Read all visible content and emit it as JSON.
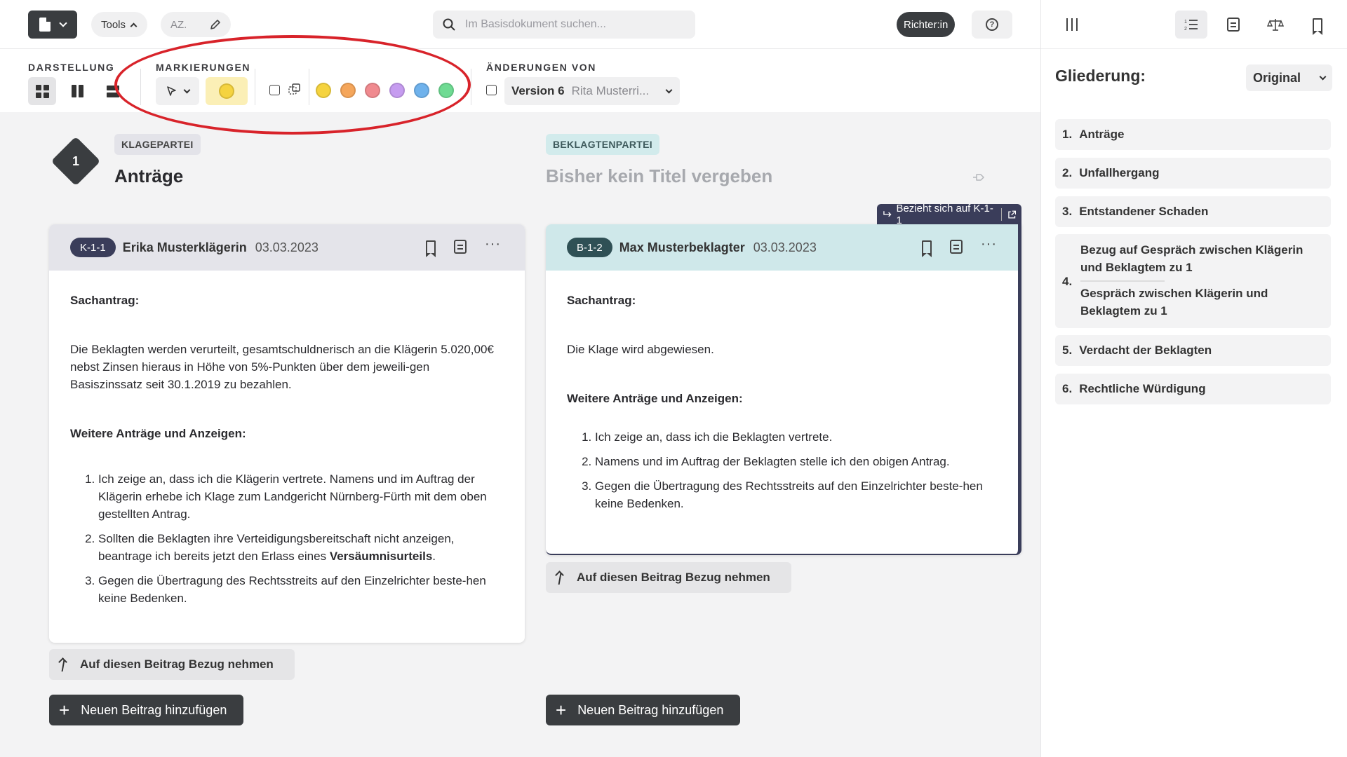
{
  "topbar": {
    "tools_label": "Tools",
    "az_label": "AZ.",
    "search_placeholder": "Im Basisdokument suchen...",
    "role_label": "Richter:in"
  },
  "toolbar": {
    "darstellung_label": "DARSTELLUNG",
    "markierungen_label": "MARKIERUNGEN",
    "aenderungen_label": "ÄNDERUNGEN VON",
    "active_highlight_color": "#f5d33f",
    "highlight_colors": [
      "#f5d33f",
      "#f5a65b",
      "#f08a8f",
      "#c69cf0",
      "#6fb2ec",
      "#6fdb93"
    ],
    "version_label": "Version 6",
    "version_author": "Rita Musterri..."
  },
  "annotation": {
    "ellipse_color": "#d8232a"
  },
  "section": {
    "number": "1",
    "kp_badge": "KLAGEPARTEI",
    "bp_badge": "BEKLAGTENPARTEI",
    "kp_title": "Anträge",
    "bp_title": "Bisher kein Titel vergeben"
  },
  "card_k": {
    "id": "K-1-1",
    "author": "Erika Musterklägerin",
    "date": "03.03.2023",
    "heading": "Sachantrag:",
    "paragraph": "Die Beklagten werden verurteilt, gesamtschuldnerisch an die Klägerin 5.020,00€ nebst Zinsen hieraus in Höhe von 5%-Punkten über dem jeweili-gen Basiszinssatz seit 30.1.2019 zu bezahlen.",
    "heading2": "Weitere Anträge und Anzeigen:",
    "items": [
      "Ich zeige an, dass ich die Klägerin vertrete. Namens und im Auftrag der Klägerin erhebe ich Klage zum Landgericht Nürnberg-Fürth mit dem oben gestellten Antrag.",
      "Sollten die Beklagten ihre Verteidigungsbereitschaft nicht anzeigen, beantrage ich bereits jetzt den Erlass eines ",
      "Gegen die Übertragung des Rechtsstreits auf den Einzelrichter beste-hen keine Bedenken."
    ],
    "item2_bold": "Versäumnisurteils",
    "item2_end": "."
  },
  "card_b": {
    "ref_tag": "Bezieht sich auf K-1-1",
    "id": "B-1-2",
    "author": "Max Musterbeklagter",
    "date": "03.03.2023",
    "heading": "Sachantrag:",
    "paragraph": "Die Klage wird abgewiesen.",
    "heading2": "Weitere Anträge und Anzeigen:",
    "items": [
      "Ich zeige an, dass ich die Beklagten vertrete.",
      "Namens und im Auftrag der Beklagten stelle ich den obigen Antrag.",
      "Gegen die Übertragung des Rechtsstreits auf den Einzelrichter beste-hen keine Bedenken."
    ]
  },
  "buttons": {
    "reference": "Auf diesen Beitrag Bezug nehmen",
    "add": "Neuen Beitrag hinzufügen"
  },
  "sidebar": {
    "title": "Gliederung:",
    "select_value": "Original",
    "items": [
      {
        "num": "1.",
        "label": "Anträge"
      },
      {
        "num": "2.",
        "label": "Unfallhergang"
      },
      {
        "num": "3.",
        "label": "Entstandener Schaden"
      },
      {
        "num": "4.",
        "label": "Bezug auf Gespräch zwischen Klägerin und Beklagtem zu 1",
        "label2": "Gespräch zwischen Klägerin und Beklagtem zu 1"
      },
      {
        "num": "5.",
        "label": "Verdacht der Beklagten"
      },
      {
        "num": "6.",
        "label": "Rechtliche Würdigung"
      }
    ]
  }
}
